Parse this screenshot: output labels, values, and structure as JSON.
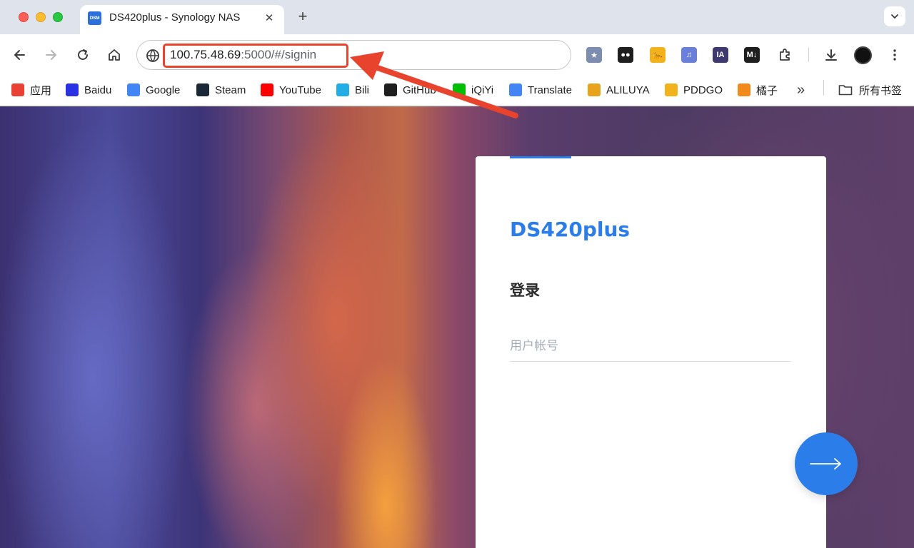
{
  "tab": {
    "favicon_text": "DSM",
    "title": "DS420plus - Synology NAS",
    "close_glyph": "✕",
    "new_tab_glyph": "+"
  },
  "omnibox": {
    "url_host": "100.75.48.69",
    "url_rest": ":5000/#/signin"
  },
  "extensions": [
    {
      "name": "bookmark-star-extension",
      "label": "★",
      "color": "#7c8db0"
    },
    {
      "name": "tampermonkey-extension",
      "label": "●●",
      "color": "#1f1f1f"
    },
    {
      "name": "dog-extension",
      "label": "🐆",
      "color": "#f2b21b"
    },
    {
      "name": "music-extension",
      "label": "♫",
      "color": "#6a7fd8"
    },
    {
      "name": "ia-extension",
      "label": "IA",
      "color": "#3f3a6e"
    },
    {
      "name": "markdown-extension",
      "label": "M↓",
      "color": "#1f1f1f"
    }
  ],
  "bookmarks": [
    {
      "name": "apps",
      "label": "应用",
      "icon": "grid-icon",
      "color": "#e94235"
    },
    {
      "name": "baidu",
      "label": "Baidu",
      "icon": "baidu-paw-icon",
      "color": "#2932e1"
    },
    {
      "name": "google",
      "label": "Google",
      "icon": "google-g-icon",
      "color": "#4285f4"
    },
    {
      "name": "steam",
      "label": "Steam",
      "icon": "steam-icon",
      "color": "#1b2838"
    },
    {
      "name": "youtube",
      "label": "YouTube",
      "icon": "youtube-icon",
      "color": "#ff0000"
    },
    {
      "name": "bili",
      "label": "Bili",
      "icon": "bilibili-icon",
      "color": "#23ade5"
    },
    {
      "name": "github",
      "label": "GitHub",
      "icon": "github-icon",
      "color": "#1f1f1f"
    },
    {
      "name": "iqiyi",
      "label": "iQiYi",
      "icon": "iqiyi-icon",
      "color": "#00be06"
    },
    {
      "name": "translate",
      "label": "Translate",
      "icon": "google-translate-icon",
      "color": "#4285f4"
    },
    {
      "name": "aliluya",
      "label": "ALILUYA",
      "icon": "aliluya-icon",
      "color": "#e8a31c"
    },
    {
      "name": "pddgo",
      "label": "PDDGO",
      "icon": "pddgo-icon",
      "color": "#f2b21b"
    },
    {
      "name": "orange",
      "label": "橘子",
      "icon": "orange-play-icon",
      "color": "#f28a1b"
    }
  ],
  "bookmarks_overflow": "»",
  "all_bookmarks": "所有书签",
  "login": {
    "hostname": "DS420plus",
    "title": "登录",
    "username_placeholder": "用户帐号"
  },
  "colors": {
    "accent": "#2b7de9",
    "annotation": "#e8432d"
  }
}
